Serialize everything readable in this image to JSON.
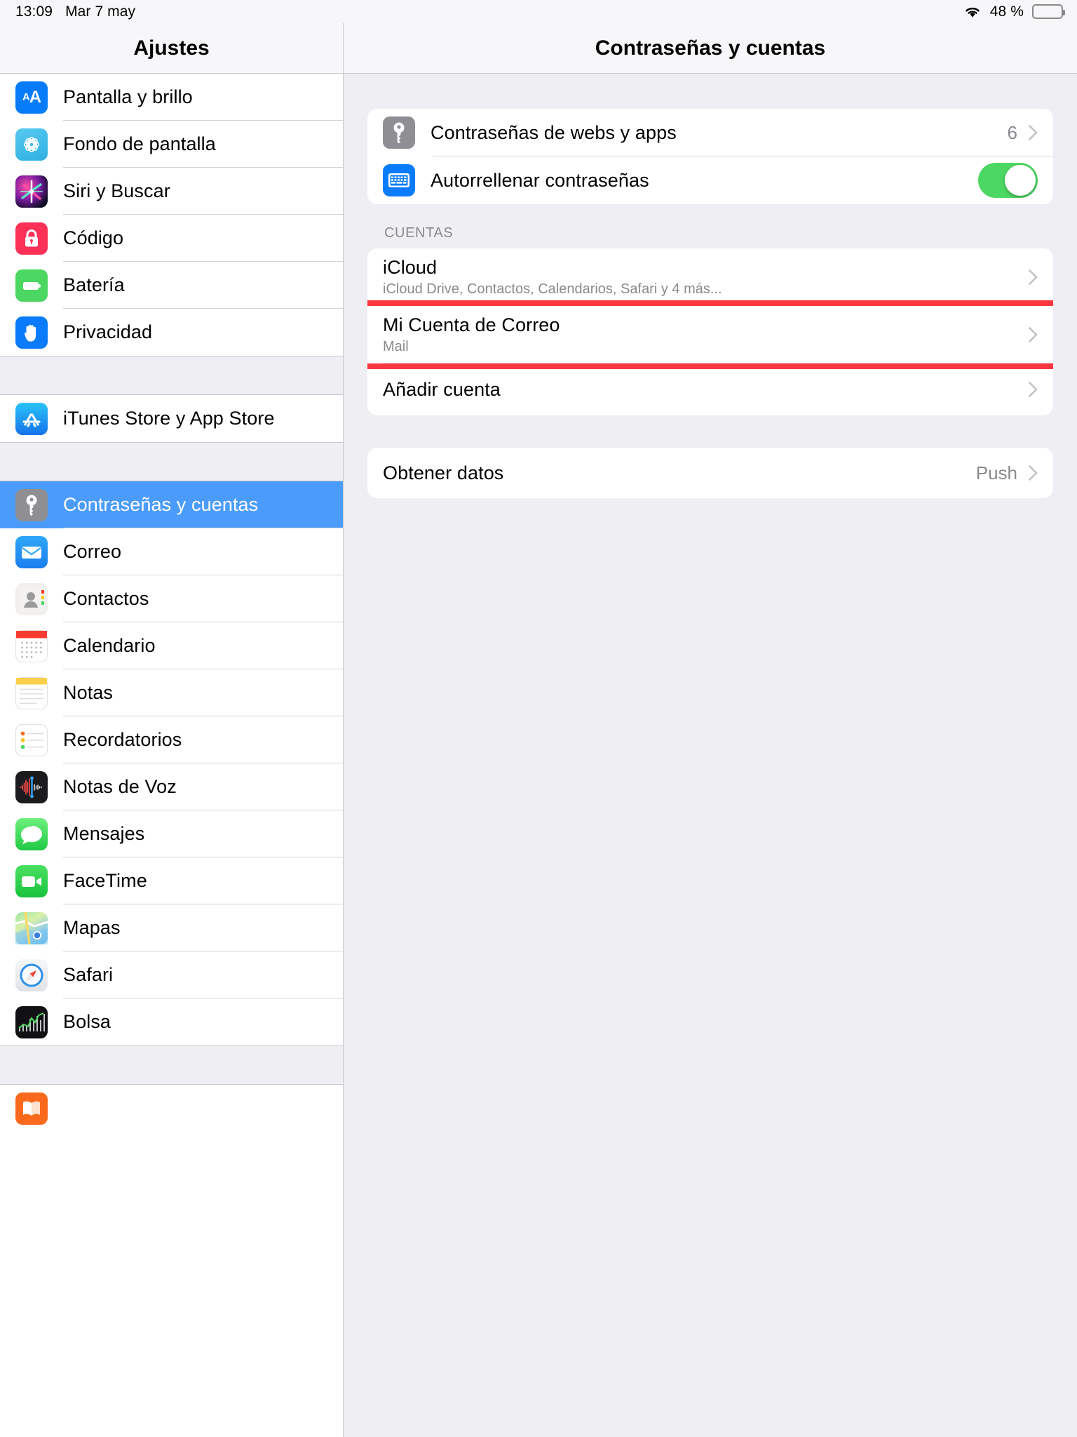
{
  "status_bar": {
    "time": "13:09",
    "date": "Mar 7 may",
    "wifi_icon": "wifi-icon",
    "battery_percent": "48 %",
    "battery_level": 48
  },
  "sidebar": {
    "title": "Ajustes",
    "groups": [
      {
        "items": [
          {
            "label": "Pantalla y brillo",
            "icon": "display-brightness-icon"
          },
          {
            "label": "Fondo de pantalla",
            "icon": "wallpaper-icon"
          },
          {
            "label": "Siri y Buscar",
            "icon": "siri-icon"
          },
          {
            "label": "Código",
            "icon": "passcode-lock-icon"
          },
          {
            "label": "Batería",
            "icon": "battery-icon"
          },
          {
            "label": "Privacidad",
            "icon": "privacy-hand-icon"
          }
        ]
      },
      {
        "items": [
          {
            "label": "iTunes Store y App Store",
            "icon": "app-store-icon"
          }
        ]
      },
      {
        "items": [
          {
            "label": "Contraseñas y cuentas",
            "icon": "key-icon",
            "selected": true
          },
          {
            "label": "Correo",
            "icon": "mail-icon"
          },
          {
            "label": "Contactos",
            "icon": "contacts-icon"
          },
          {
            "label": "Calendario",
            "icon": "calendar-icon"
          },
          {
            "label": "Notas",
            "icon": "notes-icon"
          },
          {
            "label": "Recordatorios",
            "icon": "reminders-icon"
          },
          {
            "label": "Notas de Voz",
            "icon": "voice-memos-icon"
          },
          {
            "label": "Mensajes",
            "icon": "messages-icon"
          },
          {
            "label": "FaceTime",
            "icon": "facetime-icon"
          },
          {
            "label": "Mapas",
            "icon": "maps-icon"
          },
          {
            "label": "Safari",
            "icon": "safari-icon"
          },
          {
            "label": "Bolsa",
            "icon": "stocks-icon"
          }
        ]
      },
      {
        "items": [
          {
            "label": "",
            "icon": "books-icon"
          }
        ]
      }
    ]
  },
  "detail": {
    "title": "Contraseñas y cuentas",
    "passwords_card": {
      "website_passwords": {
        "label": "Contraseñas de webs y apps",
        "count": "6",
        "icon": "key-icon",
        "chevron": "chevron-right-icon"
      },
      "autofill": {
        "label": "Autorrellenar contraseñas",
        "icon": "keyboard-icon",
        "toggle_on": true
      }
    },
    "accounts_section_header": "CUENTAS",
    "accounts": [
      {
        "label": "iCloud",
        "sublabel": "iCloud Drive, Contactos, Calendarios, Safari y 4 más...",
        "chevron": "chevron-right-icon",
        "highlighted": false
      },
      {
        "label": "Mi Cuenta de Correo",
        "sublabel": "Mail",
        "chevron": "chevron-right-icon",
        "highlighted": true
      },
      {
        "label": "Añadir cuenta",
        "sublabel": "",
        "chevron": "chevron-right-icon",
        "highlighted": false
      }
    ],
    "fetch_row": {
      "label": "Obtener datos",
      "value": "Push",
      "chevron": "chevron-right-icon"
    }
  },
  "colors": {
    "selected_row_blue": "#4b9cfa",
    "highlight_red": "#fb3640",
    "toggle_green": "#4cd662",
    "secondary_text": "#8a8a8e",
    "panel_bg": "#eeeef3"
  }
}
